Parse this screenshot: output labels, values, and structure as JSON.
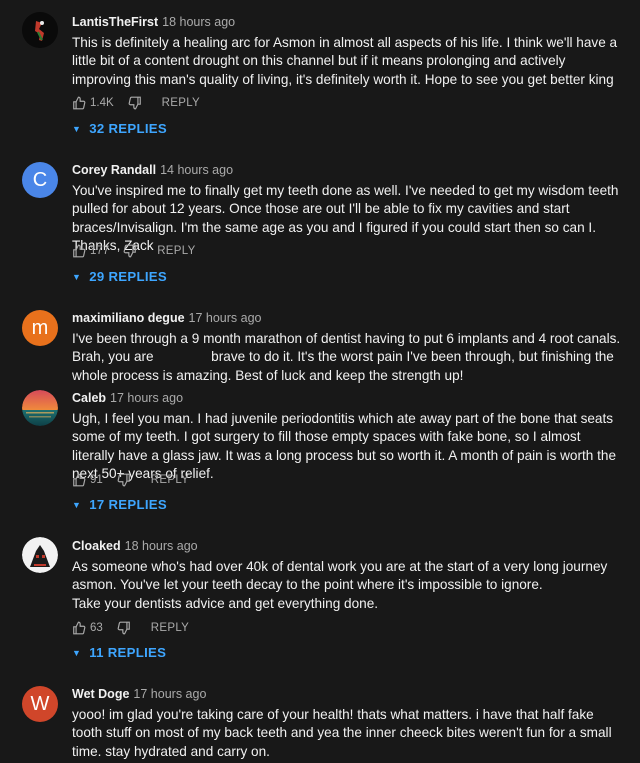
{
  "colors": {
    "background": "#181818",
    "link": "#3ea6ff",
    "muted": "#aaaaaa"
  },
  "comments": [
    {
      "author": "LantisTheFirst",
      "time": "18 hours ago",
      "text": "This is definitely a healing arc for Asmon in almost all aspects of his life. I think we'll have a little bit of a content drought on this channel but if it means prolonging and actively improving this man's quality of living, it's definitely worth it. Hope to see you get better king",
      "likes": "1.4K",
      "reply_label": "REPLY",
      "replies": "32 REPLIES"
    },
    {
      "author": "Corey Randall",
      "time": "14 hours ago",
      "avatar_letter": "C",
      "avatar_color": "#4a86e8",
      "text": "You've inspired me to finally get my teeth done as well. I've needed to get my wisdom teeth pulled for about 12 years. Once those are out I'll be able to fix my cavities and start braces/Invisalign. I'm the same age as you and I figured if you could start then so can I. Thanks, Zack",
      "likes": "177",
      "reply_label": "REPLY",
      "replies": "29 REPLIES"
    },
    {
      "author": "maximiliano degue",
      "time": "17 hours ago",
      "avatar_letter": "m",
      "avatar_color": "#e8711c",
      "text_a": "I've been through a 9 month marathon of dentist having to put 6 implants and 4 root canals. Brah, you are",
      "text_b": "brave to do it. It's the worst pain I've been through, but finishing the whole process is amazing. Best of luck and keep the strength up!"
    },
    {
      "author": "Caleb",
      "time": "17 hours ago",
      "text": "Ugh, I feel you man. I had juvenile periodontitis which ate away part of the bone that seats some of my teeth. I got surgery to fill those empty spaces with fake bone, so I almost literally have a glass jaw. It was a long process but so worth it. A month of pain is worth the next 50+ years of relief.",
      "likes": "91",
      "reply_label": "REPLY",
      "replies": "17 REPLIES"
    },
    {
      "author": "Cloaked",
      "time": "18 hours ago",
      "text": "As someone who's had over 40k of dental work you are at the start of a very long journey asmon. You've let your teeth decay to the point where it's impossible to ignore.\nTake your dentists advice and get everything done.",
      "likes": "63",
      "reply_label": "REPLY",
      "replies": "11 REPLIES"
    },
    {
      "author": "Wet Doge",
      "time": "17 hours ago",
      "avatar_letter": "W",
      "avatar_color": "#d0462a",
      "text": "yooo! im glad you're taking care of your health! thats what matters. i have that half fake tooth stuff on most of my back teeth and yea the inner cheeck bites weren't fun for a small time. stay hydrated and carry on."
    }
  ]
}
